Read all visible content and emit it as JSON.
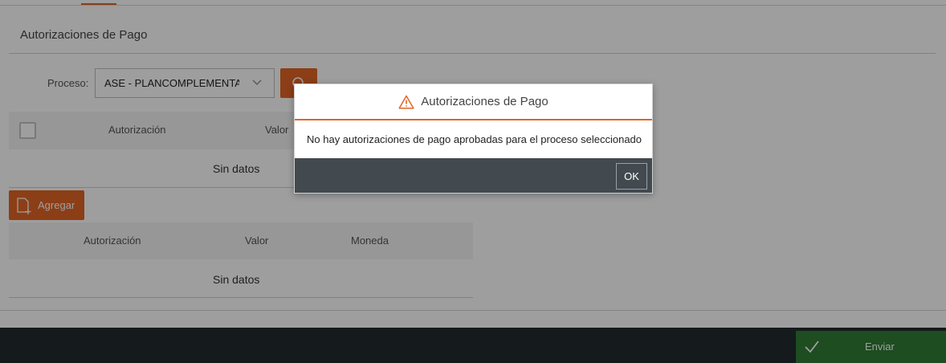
{
  "section": {
    "title": "Autorizaciones de Pago"
  },
  "filter": {
    "proceso_label": "Proceso:",
    "proceso_value": "ASE - PLANCOMPLEMENTA"
  },
  "table1": {
    "headers": [
      "Autorización",
      "Valor"
    ],
    "empty": "Sin datos"
  },
  "agregar": {
    "label": "Agregar"
  },
  "table2": {
    "headers": [
      "Autorización",
      "Valor",
      "Moneda"
    ],
    "empty": "Sin datos"
  },
  "footer": {
    "enviar_label": "Enviar"
  },
  "dialog": {
    "title": "Autorizaciones de Pago",
    "message": "No hay autorizaciones de pago aprobadas para el proceso seleccionado",
    "ok_label": "OK"
  },
  "colors": {
    "accent": "#e26524",
    "success": "#2f7d35",
    "footer": "#232a2e",
    "dialog_footer": "#434a4f"
  },
  "icons": {
    "search": "search-icon",
    "dropdown": "chevron-down-icon",
    "add": "add-document-icon",
    "warning": "warning-icon",
    "check": "check-icon"
  }
}
